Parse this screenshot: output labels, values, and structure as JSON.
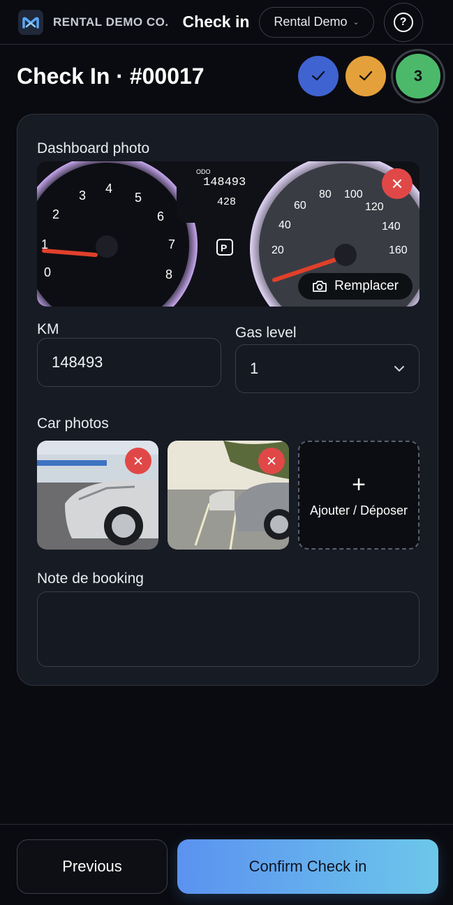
{
  "header": {
    "brand": "RENTAL DEMO CO.",
    "page_name": "Check in",
    "org_select": "Rental Demo",
    "help": "?"
  },
  "title": "Check In · #00017",
  "steps": [
    {
      "state": "done",
      "color": "#3f63d1",
      "glyph": "✓"
    },
    {
      "state": "done",
      "color": "#e4a13b",
      "glyph": "✓"
    },
    {
      "state": "current",
      "color": "#4cb96a",
      "label": "3"
    }
  ],
  "form": {
    "dashboard_label": "Dashboard photo",
    "dashboard_readout": {
      "odo_label": "ODO",
      "odo": "148493",
      "trip": "428"
    },
    "replace_label": "Remplacer",
    "km_label": "KM",
    "km_value": "148493",
    "gas_label": "Gas level",
    "gas_value": "1",
    "car_photos_label": "Car photos",
    "add_label": "Ajouter / Déposer",
    "note_label": "Note de booking",
    "note_value": ""
  },
  "footer": {
    "previous": "Previous",
    "confirm": "Confirm Check in"
  }
}
